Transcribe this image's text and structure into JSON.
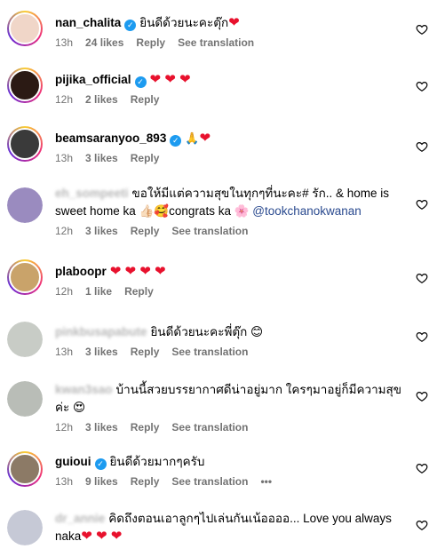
{
  "comments": [
    {
      "username": "nan_chalita",
      "verified": true,
      "text": "ยินดีด้วยนะคะตุ๊ก",
      "suffix": "❤",
      "time": "13h",
      "likes": "24 likes",
      "reply": "Reply",
      "translate": "See translation",
      "avatar_color": "#f0d6c8"
    },
    {
      "username": "pijika_official",
      "verified": true,
      "text": "",
      "suffix": "❤ ❤ ❤",
      "time": "12h",
      "likes": "2 likes",
      "reply": "Reply",
      "avatar_color": "#2b1a14"
    },
    {
      "username": "beamsaranyoo_893",
      "verified": true,
      "text": "🙏",
      "suffix": "❤",
      "time": "13h",
      "likes": "3 likes",
      "reply": "Reply",
      "avatar_color": "#3a3a3a"
    },
    {
      "username": "eh_sompeeti",
      "verified": false,
      "text": "ขอให้มีแต่ความสุขในทุกๆที่นะคะ# รัก.. 󠀠& home is sweet home ka 👍🏻🥰congrats ka 🌸",
      "mention": "@tookchanokwanan",
      "time": "12h",
      "likes": "3 likes",
      "reply": "Reply",
      "translate": "See translation",
      "avatar_color": "#9a8bbf"
    },
    {
      "username": "plaboopr",
      "verified": false,
      "text": "",
      "suffix": "❤ ❤ ❤ ❤",
      "time": "12h",
      "likes": "1 like",
      "reply": "Reply",
      "avatar_color": "#c9a36a"
    },
    {
      "username": "pinkbusapabute",
      "verified": false,
      "text": "ยินดีด้วยนะคะพี่ตุ๊ก 😊",
      "time": "13h",
      "likes": "3 likes",
      "reply": "Reply",
      "translate": "See translation",
      "avatar_color": "#c8ccc6"
    },
    {
      "username": "kwan3sao",
      "verified": false,
      "text": "บ้านนี้สวยบรรยากาศดีน่าอยู่มาก ใครๆมาอยู่ก็มีความสุขค่ะ 😍",
      "time": "12h",
      "likes": "3 likes",
      "reply": "Reply",
      "translate": "See translation",
      "avatar_color": "#b9bdb7"
    },
    {
      "username": "guioui",
      "verified": true,
      "text": "ยินดีด้วยมากๆครับ",
      "time": "13h",
      "likes": "9 likes",
      "reply": "Reply",
      "translate": "See translation",
      "more": "•••",
      "avatar_color": "#8c7a66"
    },
    {
      "username": "dr_annie",
      "verified": false,
      "text": "คิดถึงตอนเอาลูกๆไปเล่นกันเน้ออออ... Love you always naka",
      "suffix": "❤ ❤ ❤",
      "time": "",
      "likes": "",
      "reply": "",
      "avatar_color": "#c6c9d6"
    }
  ]
}
